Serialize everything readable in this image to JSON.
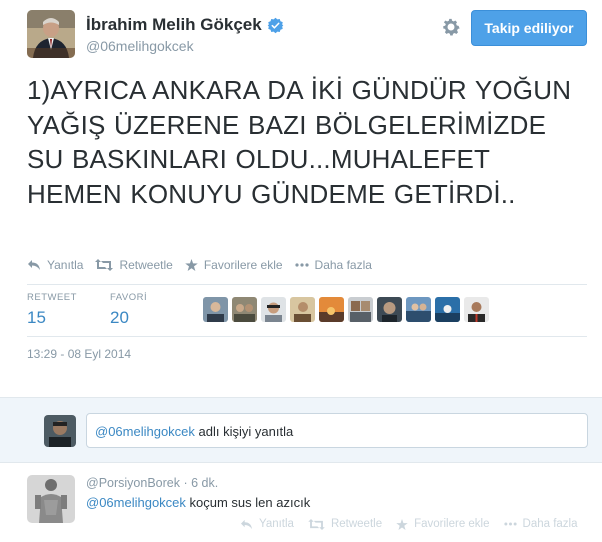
{
  "author": {
    "name": "İbrahim Melih Gökçek",
    "screen_name": "@06melihgokcek"
  },
  "follow_button_label": "Takip ediliyor",
  "tweet": {
    "text": "1)AYRICA ANKARA DA İKİ GÜNDÜR YOĞUN YAĞIŞ ÜZERENE BAZI BÖLGELERİMİZDE SU BASKINLARI OLDU...MUHALEFET HEMEN KONUYU GÜNDEME GETİRDİ..",
    "timestamp": "13:29 - 08 Eyl 2014"
  },
  "actions": {
    "reply": "Yanıtla",
    "retweet": "Retweetle",
    "favorite": "Favorilere ekle",
    "more": "Daha fazla"
  },
  "stats": {
    "retweet_label": "RETWEET",
    "retweet_count": "15",
    "favorite_label": "FAVORİ",
    "favorite_count": "20"
  },
  "reply_box": {
    "mention": "@06melihgokcek",
    "suffix": " adlı kişiyi yanıtla"
  },
  "reply": {
    "author": "@PorsiyonBorek",
    "time": "6 dk.",
    "mention": "@06melihgokcek",
    "text": " koçum sus len azıcık"
  },
  "colors": {
    "accent": "#3b88c3",
    "button": "#4ea1e8",
    "muted": "#8899a6",
    "reply_bg": "#eff5fa"
  }
}
